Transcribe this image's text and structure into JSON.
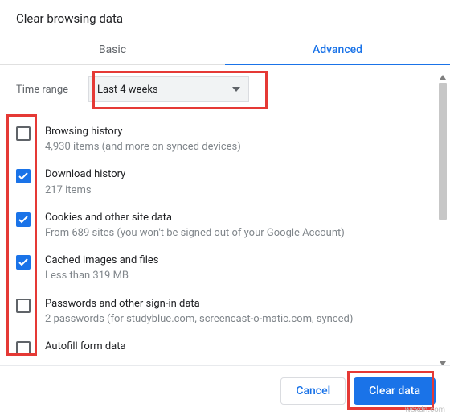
{
  "title": "Clear browsing data",
  "tabs": {
    "basic": "Basic",
    "advanced": "Advanced",
    "active": "advanced"
  },
  "time_range": {
    "label": "Time range",
    "value": "Last 4 weeks"
  },
  "items": [
    {
      "title": "Browsing history",
      "sub": "4,930 items (and more on synced devices)",
      "checked": false
    },
    {
      "title": "Download history",
      "sub": "217 items",
      "checked": true
    },
    {
      "title": "Cookies and other site data",
      "sub": "From 689 sites (you won't be signed out of your Google Account)",
      "checked": true
    },
    {
      "title": "Cached images and files",
      "sub": "Less than 319 MB",
      "checked": true
    },
    {
      "title": "Passwords and other sign-in data",
      "sub": "2 passwords (for studyblue.com, screencast-o-matic.com, synced)",
      "checked": false
    },
    {
      "title": "Autofill form data",
      "sub": "",
      "checked": false
    }
  ],
  "footer": {
    "cancel": "Cancel",
    "clear": "Clear data"
  },
  "watermark": "wsxdn.com"
}
